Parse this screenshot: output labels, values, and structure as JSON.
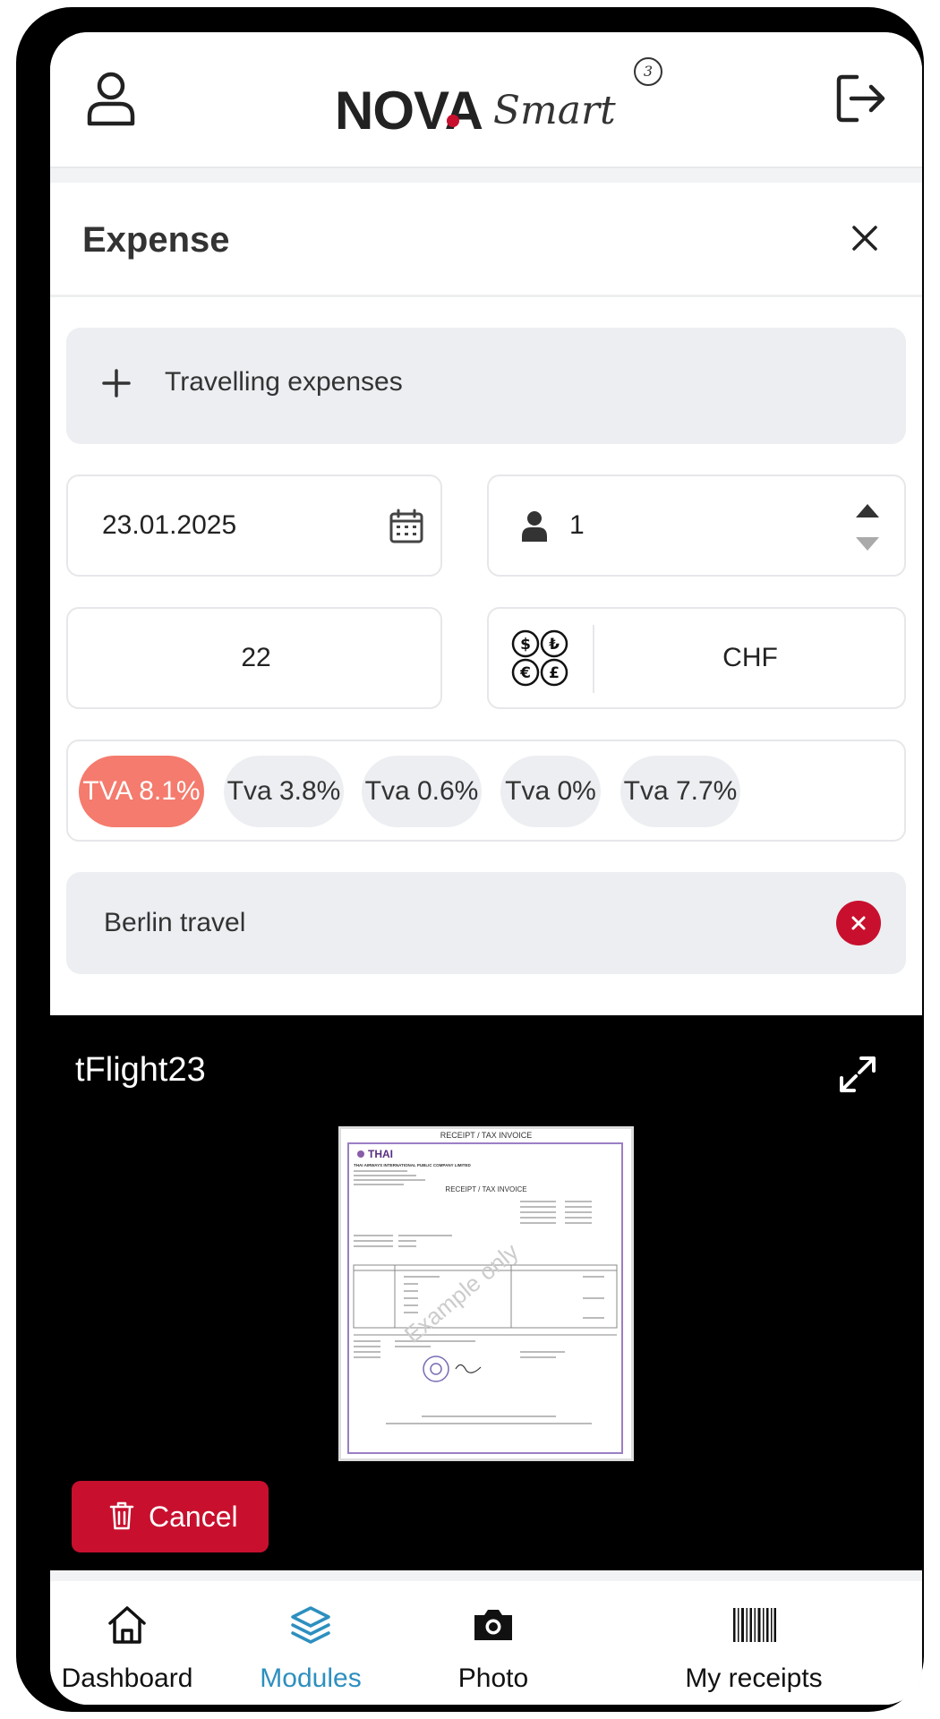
{
  "header": {
    "logo_main": "NOVA",
    "logo_sub": "Smart",
    "logo_badge": "3"
  },
  "expense": {
    "title": "Expense",
    "category_label": "Travelling expenses",
    "date_value": "23.01.2025",
    "persons_value": "1",
    "amount_value": "22",
    "currency_value": "CHF",
    "tva_options": [
      {
        "label": "TVA 8.1%",
        "selected": true
      },
      {
        "label": "Tva 3.8%",
        "selected": false
      },
      {
        "label": "Tva 0.6%",
        "selected": false
      },
      {
        "label": "Tva 0%",
        "selected": false
      },
      {
        "label": "Tva 7.7%",
        "selected": false
      }
    ],
    "note_value": "Berlin travel"
  },
  "attachment": {
    "name": "tFlight23",
    "cancel_label": "Cancel",
    "receipt": {
      "header": "RECEIPT / TAX INVOICE",
      "brand": "THAI",
      "company": "THAI AIRWAYS INTERNATIONAL PUBLIC COMPANY LIMITED",
      "title": "RECEIPT / TAX INVOICE",
      "watermark": "Example only"
    }
  },
  "nav": {
    "items": [
      {
        "label": "Dashboard",
        "icon": "home-icon",
        "active": false
      },
      {
        "label": "Modules",
        "icon": "layers-icon",
        "active": true
      },
      {
        "label": "Photo",
        "icon": "camera-icon",
        "active": false
      },
      {
        "label": "My receipts",
        "icon": "barcode-icon",
        "active": false
      }
    ]
  },
  "colors": {
    "brand_red": "#c8102e",
    "tva_selected": "#f47b6d",
    "nav_active": "#2d8fbf"
  }
}
